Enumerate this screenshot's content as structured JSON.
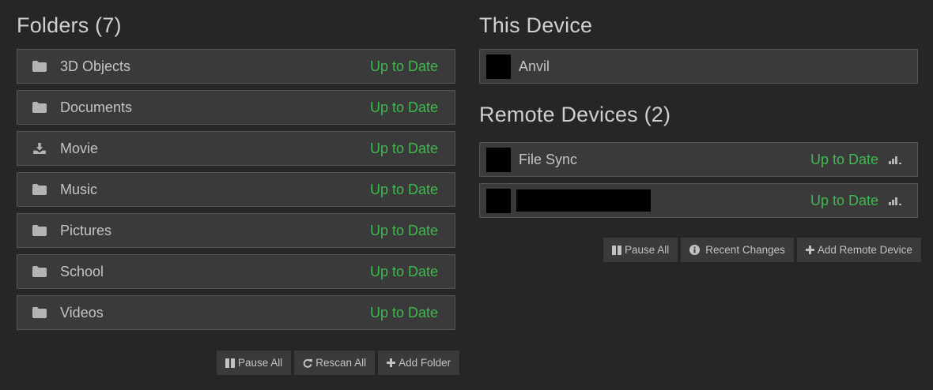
{
  "folders": {
    "title": "Folders (7)",
    "items": [
      {
        "label": "3D Objects",
        "status": "Up to Date",
        "icon": "folder-icon"
      },
      {
        "label": "Documents",
        "status": "Up to Date",
        "icon": "folder-icon"
      },
      {
        "label": "Movie",
        "status": "Up to Date",
        "icon": "download-icon"
      },
      {
        "label": "Music",
        "status": "Up to Date",
        "icon": "folder-icon"
      },
      {
        "label": "Pictures",
        "status": "Up to Date",
        "icon": "folder-icon"
      },
      {
        "label": "School",
        "status": "Up to Date",
        "icon": "folder-icon"
      },
      {
        "label": "Videos",
        "status": "Up to Date",
        "icon": "folder-icon"
      }
    ],
    "buttons": {
      "pause_all": "Pause All",
      "rescan_all": "Rescan All",
      "add_folder": "Add Folder"
    }
  },
  "this_device": {
    "title": "This Device",
    "name": "Anvil"
  },
  "remote_devices": {
    "title": "Remote Devices (2)",
    "items": [
      {
        "name": "File Sync",
        "status": "Up to Date"
      },
      {
        "name": "",
        "status": "Up to Date"
      }
    ],
    "buttons": {
      "pause_all": "Pause All",
      "recent_changes": "Recent Changes",
      "add_remote_device": "Add Remote Device"
    }
  },
  "colors": {
    "background": "#262626",
    "panel": "#3a3a3a",
    "status_ok": "#3fb950",
    "text": "#c4c4c4"
  }
}
